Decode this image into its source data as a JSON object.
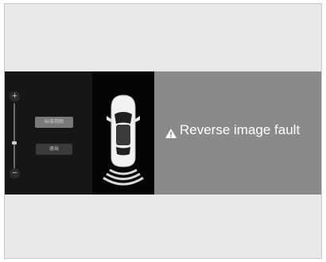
{
  "rear_view": {
    "zoom_in_symbol": "+",
    "zoom_out_symbol": "−",
    "buttons": [
      {
        "label": "标准视图"
      },
      {
        "label": "退出"
      }
    ],
    "fault_message": "Reverse image fault",
    "fault_icon": "warning-triangle-icon"
  },
  "colors": {
    "fault_background": "#8a8a8a",
    "camera_background": "#111111",
    "parking_sensor": "#d9d9d9"
  }
}
